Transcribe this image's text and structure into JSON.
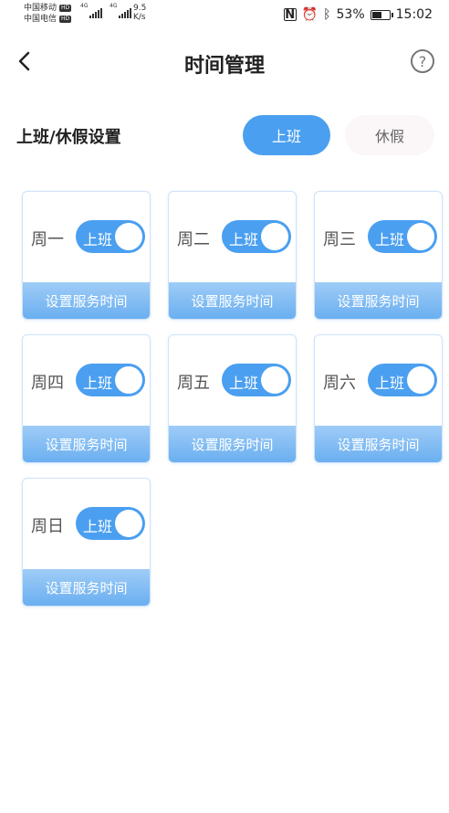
{
  "status_bar": {
    "carrier1": "中国移动",
    "carrier2": "中国电信",
    "hd": "HD",
    "net1": "4G",
    "net2": "4G",
    "speed_value": "9.5",
    "speed_unit": "K/s",
    "battery": "53%",
    "time": "15:02",
    "battery_level": 0.53
  },
  "header": {
    "title": "时间管理",
    "help_glyph": "?"
  },
  "setting": {
    "label": "上班/休假设置",
    "on_option": "上班",
    "off_option": "休假"
  },
  "days": [
    {
      "day": "周一",
      "toggle_label": "上班",
      "service_button": "设置服务时间"
    },
    {
      "day": "周二",
      "toggle_label": "上班",
      "service_button": "设置服务时间"
    },
    {
      "day": "周三",
      "toggle_label": "上班",
      "service_button": "设置服务时间"
    },
    {
      "day": "周四",
      "toggle_label": "上班",
      "service_button": "设置服务时间"
    },
    {
      "day": "周五",
      "toggle_label": "上班",
      "service_button": "设置服务时间"
    },
    {
      "day": "周六",
      "toggle_label": "上班",
      "service_button": "设置服务时间"
    },
    {
      "day": "周日",
      "toggle_label": "上班",
      "service_button": "设置服务时间"
    }
  ],
  "colors": {
    "accent": "#4a9ff0",
    "card_button_top": "#9fccf7",
    "card_button_bottom": "#6aaff0",
    "off_segment_bg": "#fbf6f8"
  }
}
